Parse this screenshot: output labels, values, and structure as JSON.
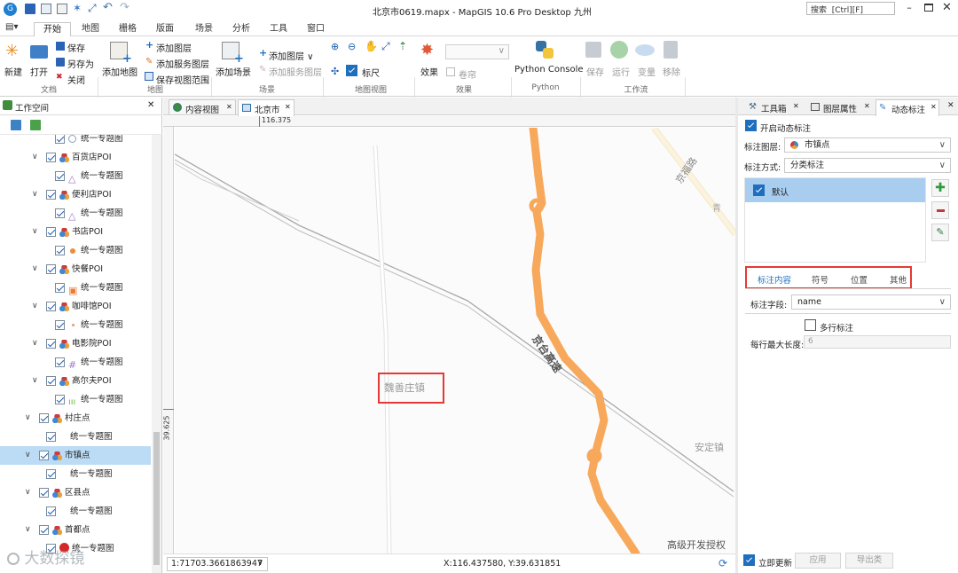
{
  "title_bar": {
    "title": "北京市0619.mapx - MapGIS 10.6 Pro Desktop 九州",
    "search_placeholder": "搜索  [Ctrl][F]"
  },
  "ribbon_tabs": [
    "开始",
    "地图",
    "栅格",
    "版面",
    "场景",
    "分析",
    "工具",
    "窗口"
  ],
  "ribbon": {
    "doc": {
      "new": "新建",
      "open": "打开",
      "save": "保存",
      "save_as": "另存为",
      "close": "关闭",
      "group": "文档"
    },
    "map": {
      "add_map": "添加地图",
      "add_layer": "添加图层",
      "add_service_layer": "添加服务图层",
      "save_view_range": "保存视图范围",
      "group": "地图"
    },
    "scene": {
      "add_scene": "添加场景",
      "add_layer": "添加图层",
      "add_service_layer": "添加服务图层",
      "group": "场景"
    },
    "map_view": {
      "scale_ruler": "标尺",
      "group": "地图视图"
    },
    "effect": {
      "effect": "效果",
      "roller": "卷帘",
      "group": "效果"
    },
    "python": {
      "console": "Python Console",
      "group": "Python"
    },
    "workflow": {
      "save": "保存",
      "run": "运行",
      "var": "变量",
      "remove": "移除",
      "group": "工作流"
    }
  },
  "workspace": {
    "title": "工作空间"
  },
  "tree": [
    {
      "label": "统一专题图",
      "indent": 3,
      "checked": true,
      "symbol": "circle-outline"
    },
    {
      "label": "百货店POI",
      "indent": 2,
      "checked": true,
      "symbol": "layer"
    },
    {
      "label": "统一专题图",
      "indent": 3,
      "checked": true,
      "symbol": "triangle-purple"
    },
    {
      "label": "便利店POI",
      "indent": 2,
      "checked": true,
      "symbol": "layer"
    },
    {
      "label": "统一专题图",
      "indent": 3,
      "checked": true,
      "symbol": "triangle-purple"
    },
    {
      "label": "书店POI",
      "indent": 2,
      "checked": true,
      "symbol": "layer"
    },
    {
      "label": "统一专题图",
      "indent": 3,
      "checked": true,
      "symbol": "dot-orange"
    },
    {
      "label": "快餐POI",
      "indent": 2,
      "checked": true,
      "symbol": "layer"
    },
    {
      "label": "统一专题图",
      "indent": 3,
      "checked": true,
      "symbol": "square-orange"
    },
    {
      "label": "咖啡馆POI",
      "indent": 2,
      "checked": true,
      "symbol": "layer"
    },
    {
      "label": "统一专题图",
      "indent": 3,
      "checked": true,
      "symbol": "dot-small"
    },
    {
      "label": "电影院POI",
      "indent": 2,
      "checked": true,
      "symbol": "layer"
    },
    {
      "label": "统一专题图",
      "indent": 3,
      "checked": true,
      "symbol": "hash-purple"
    },
    {
      "label": "高尔夫POI",
      "indent": 2,
      "checked": true,
      "symbol": "layer"
    },
    {
      "label": "统一专题图",
      "indent": 3,
      "checked": true,
      "symbol": "grass-green"
    },
    {
      "label": "村庄点",
      "indent": 1,
      "checked": true,
      "symbol": "layer"
    },
    {
      "label": "统一专题图",
      "indent": 2,
      "checked": true,
      "symbol": "none"
    },
    {
      "label": "市镇点",
      "indent": 1,
      "checked": true,
      "symbol": "layer"
    },
    {
      "label": "统一专题图",
      "indent": 2,
      "checked": true,
      "symbol": "none"
    },
    {
      "label": "区县点",
      "indent": 1,
      "checked": true,
      "symbol": "layer"
    },
    {
      "label": "统一专题图",
      "indent": 2,
      "checked": true,
      "symbol": "none"
    },
    {
      "label": "首都点",
      "indent": 1,
      "checked": true,
      "symbol": "layer"
    },
    {
      "label": "统一专题图",
      "indent": 2,
      "checked": true,
      "symbol": "red-star"
    }
  ],
  "map_tabs": [
    {
      "label": "内容视图"
    },
    {
      "label": "北京市"
    }
  ],
  "map": {
    "ruler_top": "116.375",
    "ruler_left": "39.625",
    "labels": {
      "highway": "京台高速",
      "road_top_right": "京福路",
      "town_edge": "安定镇",
      "town_selected": "魏善庄镇",
      "partial_right": "青"
    },
    "watermark": "高级开发授权",
    "brand_watermark": "大数探镜"
  },
  "status": {
    "scale": "1:71703.3661863947",
    "coords": "X:116.437580, Y:39.631851"
  },
  "right_tabs": [
    {
      "label": "工具箱"
    },
    {
      "label": "图层属性"
    },
    {
      "label": "动态标注"
    }
  ],
  "dyn": {
    "enable": "开启动态标注",
    "layer_label": "标注图层:",
    "layer_value": "市镇点",
    "method_label": "标注方式:",
    "method_value": "分类标注",
    "list_item": "默认",
    "subtabs": [
      "标注内容",
      "符号",
      "位置",
      "其他"
    ],
    "field_label": "标注字段:",
    "field_value": "name",
    "multiline": "多行标注",
    "maxlen_label": "每行最大长度:",
    "maxlen_value": "6",
    "instant": "立即更新",
    "apply": "应用",
    "export": "导出类"
  },
  "colors": {
    "highway": "#f7a85a",
    "select_red": "#e53935",
    "accent": "#1f6fbf",
    "tree_sel": "#bcdcf5"
  }
}
